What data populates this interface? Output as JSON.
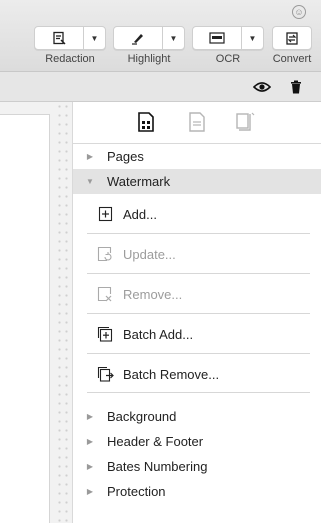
{
  "toolbar": {
    "tools": [
      {
        "label": "Redaction",
        "icon": "redaction-icon"
      },
      {
        "label": "Highlight",
        "icon": "highlight-pen-icon"
      },
      {
        "label": "OCR",
        "icon": "ocr-icon"
      },
      {
        "label": "Convert",
        "icon": "convert-icon"
      }
    ]
  },
  "panel": {
    "sections": [
      {
        "label": "Pages",
        "expanded": false
      },
      {
        "label": "Watermark",
        "expanded": true
      },
      {
        "label": "Background",
        "expanded": false
      },
      {
        "label": "Header & Footer",
        "expanded": false
      },
      {
        "label": "Bates Numbering",
        "expanded": false
      },
      {
        "label": "Protection",
        "expanded": false
      }
    ],
    "watermark_actions": [
      {
        "label": "Add...",
        "enabled": true
      },
      {
        "label": "Update...",
        "enabled": false
      },
      {
        "label": "Remove...",
        "enabled": false
      },
      {
        "label": "Batch Add...",
        "enabled": true
      },
      {
        "label": "Batch Remove...",
        "enabled": true
      }
    ]
  }
}
